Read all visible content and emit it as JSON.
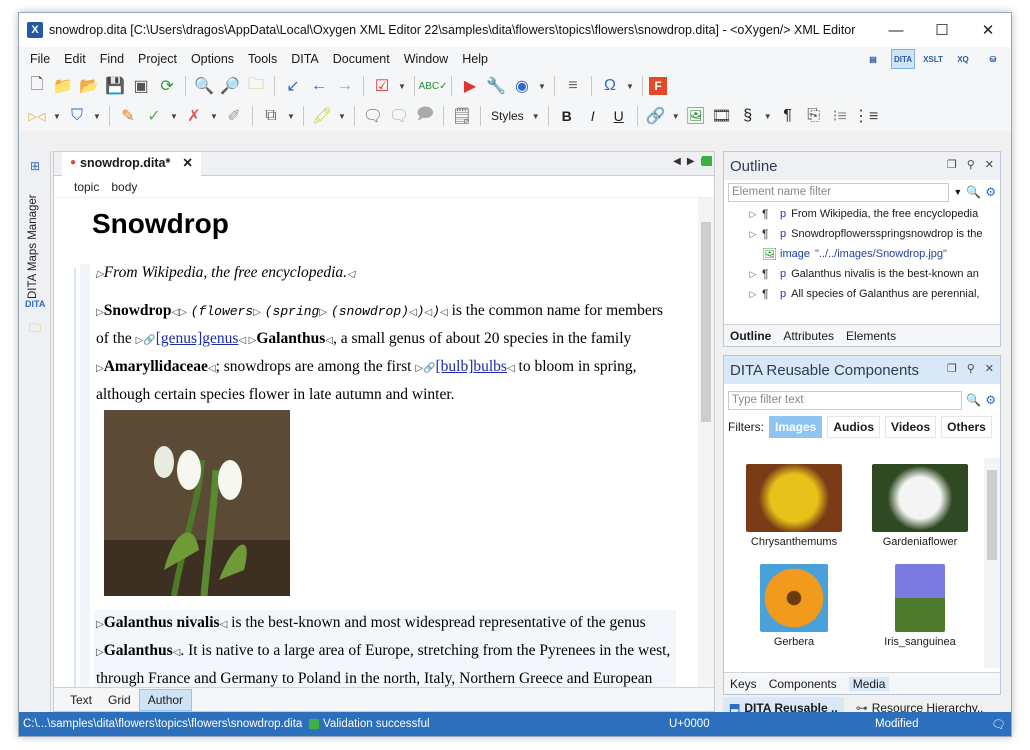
{
  "window": {
    "title": "snowdrop.dita [C:\\Users\\dragos\\AppData\\Local\\Oxygen XML Editor 22\\samples\\dita\\flowers\\topics\\flowers\\snowdrop.dita] - <oXygen/> XML Editor",
    "app_icon": "X",
    "minimize": "—",
    "maximize": "☐",
    "close": "✕"
  },
  "menu": [
    "File",
    "Edit",
    "Find",
    "Project",
    "Options",
    "Tools",
    "DITA",
    "Document",
    "Window",
    "Help"
  ],
  "perspectives": [
    "",
    "DITA",
    "XSLT",
    "XQ",
    ""
  ],
  "toolbar2": {
    "styles_label": "Styles"
  },
  "side": {
    "maps_manager_label": "DITA Maps Manager"
  },
  "editor": {
    "tab_label": "snowdrop.dita*",
    "breadcrumb": [
      "topic",
      "body"
    ],
    "heading": "Snowdrop",
    "shortdesc": "From Wikipedia, the free encyclopedia.",
    "p1": {
      "term": "Snowdrop",
      "code1": "(flowers",
      "code2": "(spring",
      "code3": "(snowdrop)",
      "code_end": ")",
      "text1": "is the common name for members",
      "text2": "of the",
      "link1_ref": "[genus]",
      "link1_text": "genus",
      "genus": "Galanthus",
      "text3": ", a small genus of about 20 species in the family",
      "family": "Amaryllidaceae",
      "text4": "; snowdrops are among the first",
      "link2_ref": "[bulb]",
      "link2_text": "bulbs",
      "text5": "to bloom in spring,",
      "text6": "although certain species flower in late autumn and winter."
    },
    "p2": {
      "term": "Galanthus nivalis",
      "text1": "is the best-known and most widespread representative of the genus",
      "term2": "Galanthus",
      "text2": ". It is native to a large area of Europe, stretching from the Pyrenees in the west,",
      "text3": "through France and Germany to Poland in the north, Italy, Northern Greece and European"
    },
    "modes": [
      "Text",
      "Grid",
      "Author"
    ]
  },
  "outline": {
    "title": "Outline",
    "filter_placeholder": "Element name filter",
    "rows": [
      {
        "el": "p",
        "text": "From Wikipedia, the free encyclopedia"
      },
      {
        "el": "p",
        "text": "Snowdropflowersspringsnowdrop is the"
      },
      {
        "el": "image",
        "text": "\"../../images/Snowdrop.jpg\""
      },
      {
        "el": "p",
        "text": "Galanthus nivalis is the best-known an"
      },
      {
        "el": "p",
        "text": "All species of Galanthus are perennial,"
      }
    ],
    "tabs": [
      "Outline",
      "Attributes",
      "Elements"
    ]
  },
  "reusable": {
    "title": "DITA Reusable Components",
    "filter_placeholder": "Type filter text",
    "filters_label": "Filters:",
    "chips": [
      "Images",
      "Audios",
      "Videos",
      "Others"
    ],
    "media": [
      {
        "name": "Chrysanthemums",
        "color": "#d9b312"
      },
      {
        "name": "Gardeniaflower",
        "color": "#f4f4f4"
      },
      {
        "name": "Gerbera",
        "color": "#f29a1c"
      },
      {
        "name": "Iris_sanguinea",
        "color": "#6a6ad8"
      }
    ],
    "tabs": [
      "Keys",
      "Components",
      "Media"
    ]
  },
  "bottom_tabs": [
    "DITA Reusable ..",
    "Resource Hierarchy.."
  ],
  "status": {
    "path": "C:\\...\\samples\\dita\\flowers\\topics\\flowers\\snowdrop.dita",
    "validation": "Validation successful",
    "char": "U+0000",
    "state": "Modified"
  },
  "colors": {
    "accent": "#2c6fbd",
    "ok": "#3cb043"
  }
}
